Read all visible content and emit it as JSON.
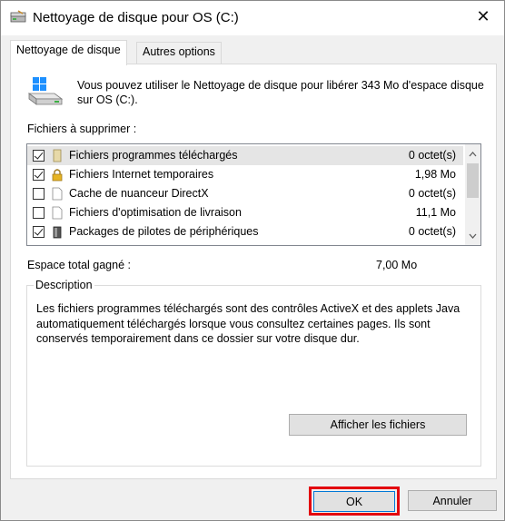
{
  "window": {
    "title": "Nettoyage de disque pour OS (C:)",
    "close_glyph": "✕"
  },
  "tabs": [
    {
      "label": "Nettoyage de disque",
      "active": true
    },
    {
      "label": "Autres options",
      "active": false
    }
  ],
  "intro_text": "Vous pouvez utiliser le Nettoyage de disque pour libérer 343 Mo d'espace disque sur OS (C:).",
  "files_label": "Fichiers à supprimer :",
  "files": [
    {
      "label": "Fichiers programmes téléchargés",
      "size": "0 octet(s)",
      "checked": true,
      "selected": true,
      "icon": "folder-icon"
    },
    {
      "label": "Fichiers Internet temporaires",
      "size": "1,98 Mo",
      "checked": true,
      "selected": false,
      "icon": "lock-icon"
    },
    {
      "label": "Cache de nuanceur DirectX",
      "size": "0 octet(s)",
      "checked": false,
      "selected": false,
      "icon": "file-icon"
    },
    {
      "label": "Fichiers d'optimisation de livraison",
      "size": "11,1 Mo",
      "checked": false,
      "selected": false,
      "icon": "file-icon"
    },
    {
      "label": "Packages de pilotes de périphériques",
      "size": "0 octet(s)",
      "checked": true,
      "selected": false,
      "icon": "device-icon"
    }
  ],
  "gain": {
    "label": "Espace total gagné :",
    "value": "7,00 Mo"
  },
  "description": {
    "legend": "Description",
    "text": "Les fichiers programmes téléchargés sont des contrôles ActiveX et des applets Java automatiquement téléchargés lorsque vous consultez certaines pages. Ils sont conservés temporairement dans ce dossier sur votre disque dur.",
    "view_files_label": "Afficher les fichiers"
  },
  "buttons": {
    "ok": "OK",
    "cancel": "Annuler"
  },
  "colors": {
    "highlight": "#e3000f",
    "accent": "#0078d7"
  }
}
